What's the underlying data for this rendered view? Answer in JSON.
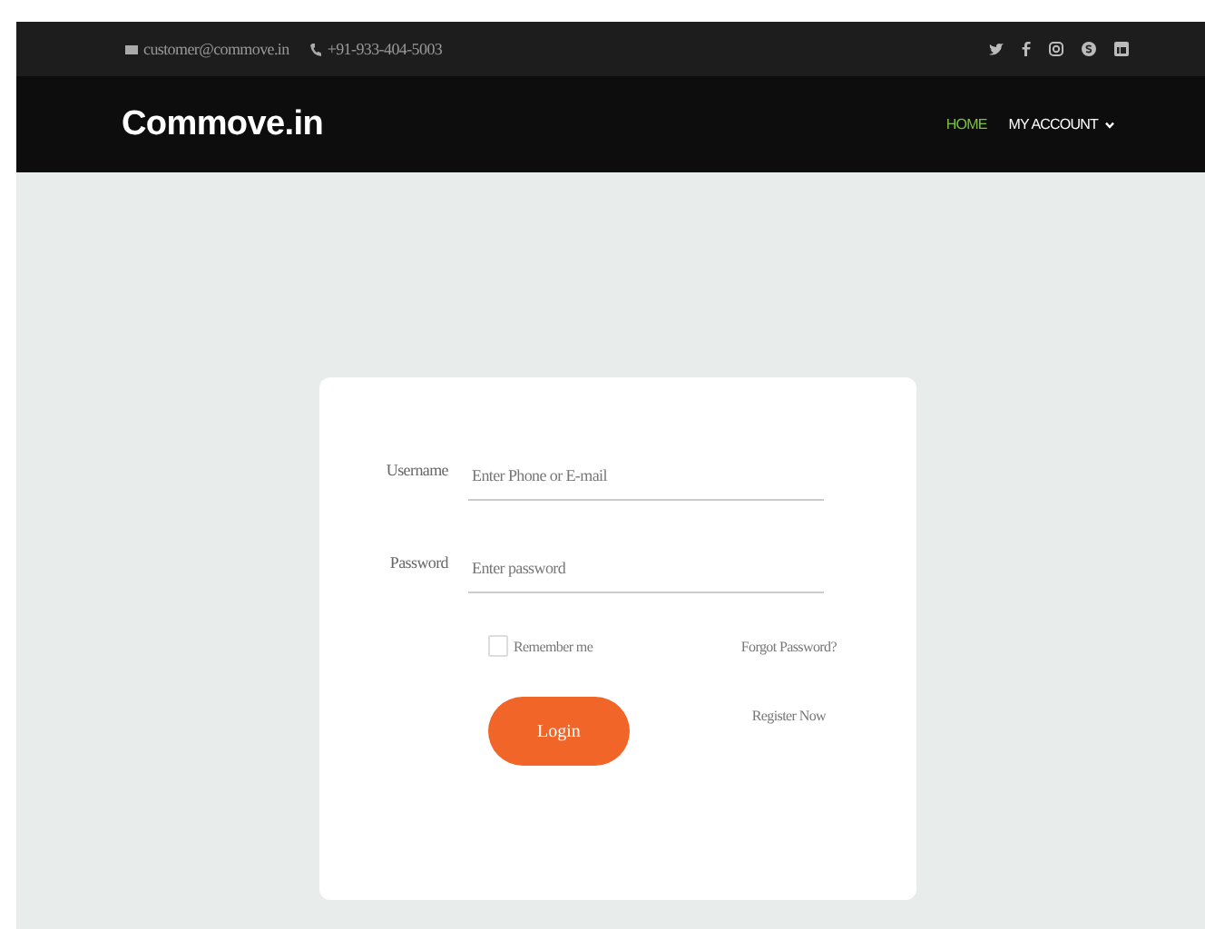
{
  "topbar": {
    "email": "customer@commove.in",
    "phone": "+91-933-404-5003",
    "social": [
      {
        "kind": "twitter"
      },
      {
        "kind": "facebook"
      },
      {
        "kind": "instagram"
      },
      {
        "kind": "skype"
      },
      {
        "kind": "linkedin"
      }
    ]
  },
  "header": {
    "logo": "Commove.in",
    "nav": [
      {
        "label": "HOME",
        "selected": true,
        "dropdown": false
      },
      {
        "label": "MY ACCOUNT",
        "selected": false,
        "dropdown": true
      }
    ]
  },
  "login": {
    "fields": [
      {
        "label": "Username",
        "placeholder": "Enter Phone or E-mail"
      },
      {
        "label": "Password",
        "placeholder": "Enter password"
      }
    ],
    "remember": {
      "label": "Remember me",
      "checked": false
    },
    "forgot": "Forgot Password?",
    "button": "Login",
    "register": "Register Now"
  }
}
